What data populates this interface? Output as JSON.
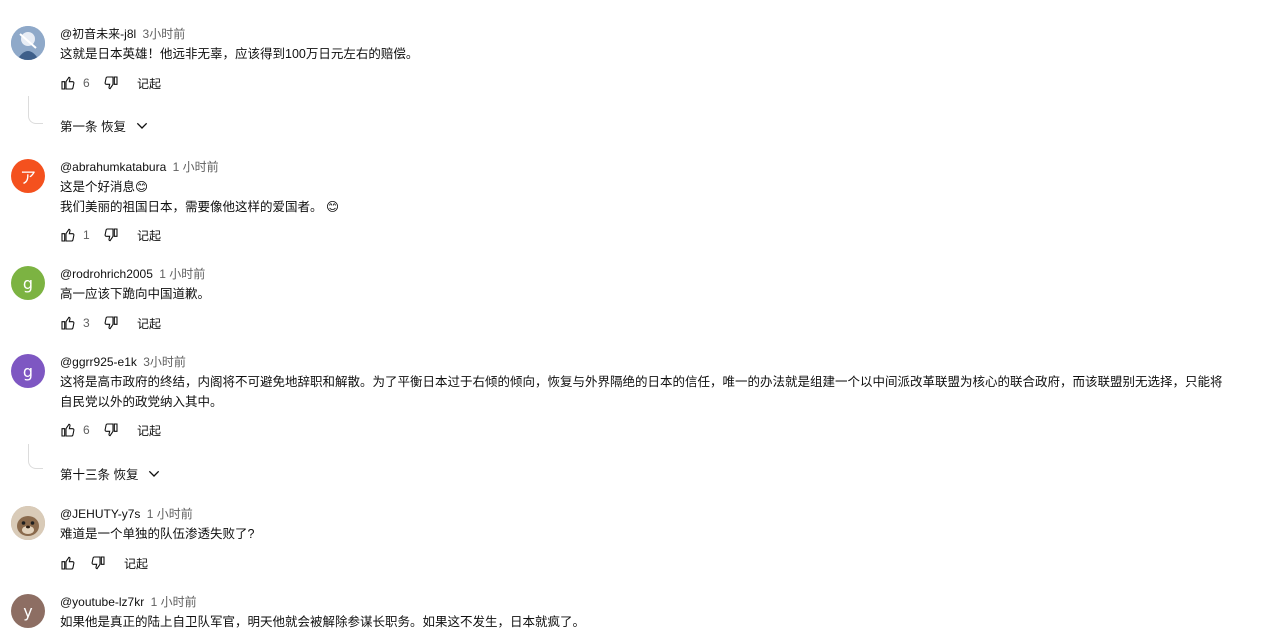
{
  "comments": [
    {
      "handle": "@初音未来-j8l",
      "time": "3小时前",
      "lines": [
        "这就是日本英雄！他远非无辜，应该得到100万日元左右的赔偿。"
      ],
      "likes": "6",
      "reply_label": "记起",
      "replies_label": "第一条 恢复",
      "avatar_icon": "anime-avatar-icon"
    },
    {
      "handle": "@abrahumkatabura",
      "time": "1 小时前",
      "lines": [
        "这是个好消息😊",
        "我们美丽的祖国日本，需要像他这样的爱国者。 😊"
      ],
      "likes": "1",
      "reply_label": "记起",
      "avatar_letter": "ア",
      "avatar_color": "#f4511e"
    },
    {
      "handle": "@rodrohrich2005",
      "time": "1 小时前",
      "lines": [
        "高一应该下跪向中国道歉。"
      ],
      "likes": "3",
      "reply_label": "记起",
      "avatar_letter": "g",
      "avatar_color": "#7cb342"
    },
    {
      "handle": "@ggrr925-e1k",
      "time": "3小时前",
      "lines": [
        "这将是高市政府的终结，内阁将不可避免地辞职和解散。为了平衡日本过于右倾的倾向，恢复与外界隔绝的日本的信任，唯一的办法就是组建一个以中间派改革联盟为核心的联合政府，而该联盟别无选择，只能将",
        "自民党以外的政党纳入其中。"
      ],
      "likes": "6",
      "reply_label": "记起",
      "replies_label": "第十三条 恢复",
      "avatar_letter": "g",
      "avatar_color": "#7e57c2"
    },
    {
      "handle": "@JEHUTY-y7s",
      "time": "1 小时前",
      "lines": [
        "难道是一个单独的队伍渗透失败了?"
      ],
      "likes": "",
      "reply_label": "记起",
      "avatar_icon": "otter-avatar-icon"
    },
    {
      "handle": "@youtube-lz7kr",
      "time": "1 小时前",
      "lines": [
        "如果他是真正的陆上自卫队军官，明天他就会被解除参谋长职务。如果这不发生，日本就疯了。"
      ],
      "avatar_letter": "y",
      "avatar_color": "#8d6e63"
    }
  ]
}
